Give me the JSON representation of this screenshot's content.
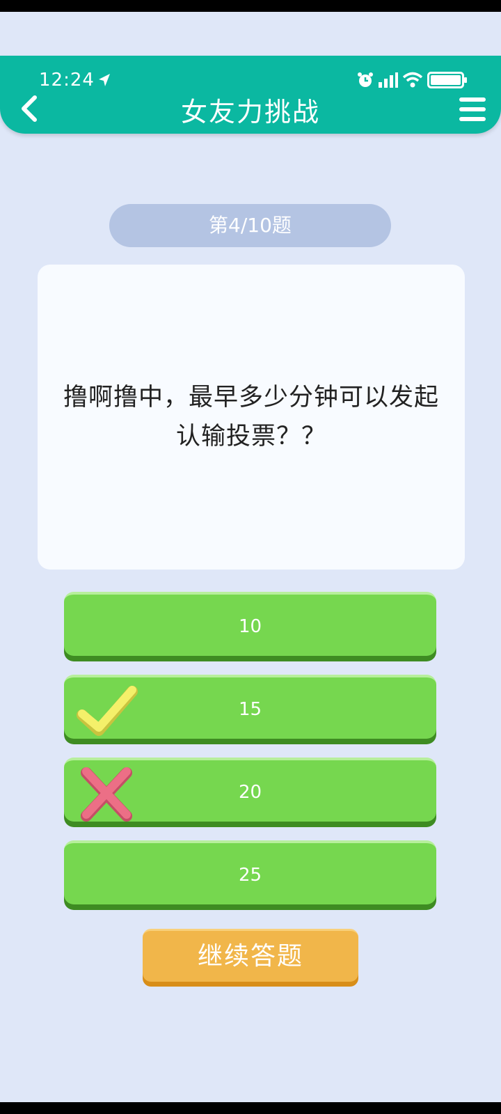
{
  "status_bar": {
    "time": "12:24"
  },
  "header": {
    "title": "女友力挑战"
  },
  "progress": {
    "label": "第4/10题"
  },
  "question": {
    "text": "撸啊撸中，最早多少分钟可以发起认输投票？？"
  },
  "options": [
    {
      "label": "10",
      "mark": "none"
    },
    {
      "label": "15",
      "mark": "correct"
    },
    {
      "label": "20",
      "mark": "wrong"
    },
    {
      "label": "25",
      "mark": "none"
    }
  ],
  "continue_button": {
    "label": "继续答题"
  },
  "colors": {
    "header": "#0bb8a1",
    "background": "#dfe7f8",
    "option_green": "#76d74f",
    "continue_orange": "#f1b64a",
    "check_yellow": "#f4f06a",
    "cross_pink": "#ec6f86"
  },
  "icons": [
    "back-arrow-icon",
    "menu-icon",
    "location-arrow-icon",
    "alarm-icon",
    "signal-icon",
    "wifi-icon",
    "battery-icon",
    "check-mark-icon",
    "cross-mark-icon"
  ]
}
